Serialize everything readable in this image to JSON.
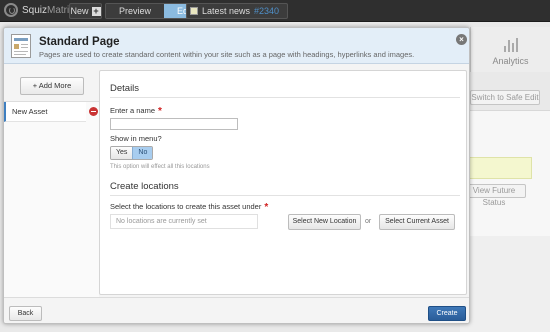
{
  "topbar": {
    "logo_word": "Squiz",
    "logo_word2": "Matrix",
    "new_label": "New",
    "preview_label": "Preview",
    "edit_label": "Edit",
    "news_label": "Latest news",
    "news_id": "#2340"
  },
  "background": {
    "analytics_label": "Analytics",
    "safe_edit_label": "Switch to Safe Edit",
    "future_status_label": "View Future Status"
  },
  "dialog": {
    "title": "Standard Page",
    "subtitle": "Pages are used to create standard content within your site such as a page with headings, hyperlinks and images.",
    "add_more_label": "+ Add More",
    "assets": [
      {
        "label": "New Asset"
      }
    ],
    "details": {
      "heading": "Details",
      "name_label": "Enter a name",
      "name_value": "",
      "show_in_menu_label": "Show in menu?",
      "yes_label": "Yes",
      "no_label": "No",
      "selected": "No",
      "hint": "This option will effect all this locations"
    },
    "locations": {
      "heading": "Create locations",
      "select_label": "Select the locations to create this asset under",
      "placeholder": "No locations are currently set",
      "select_new_label": "Select New Location",
      "or_label": "or",
      "select_current_label": "Select Current Asset"
    },
    "footer": {
      "back_label": "Back",
      "create_label": "Create"
    }
  },
  "colors": {
    "accent": "#3f7fc0",
    "create_button": "#2f66a6",
    "required": "#d12020",
    "header_bg": "#e3eef8"
  }
}
